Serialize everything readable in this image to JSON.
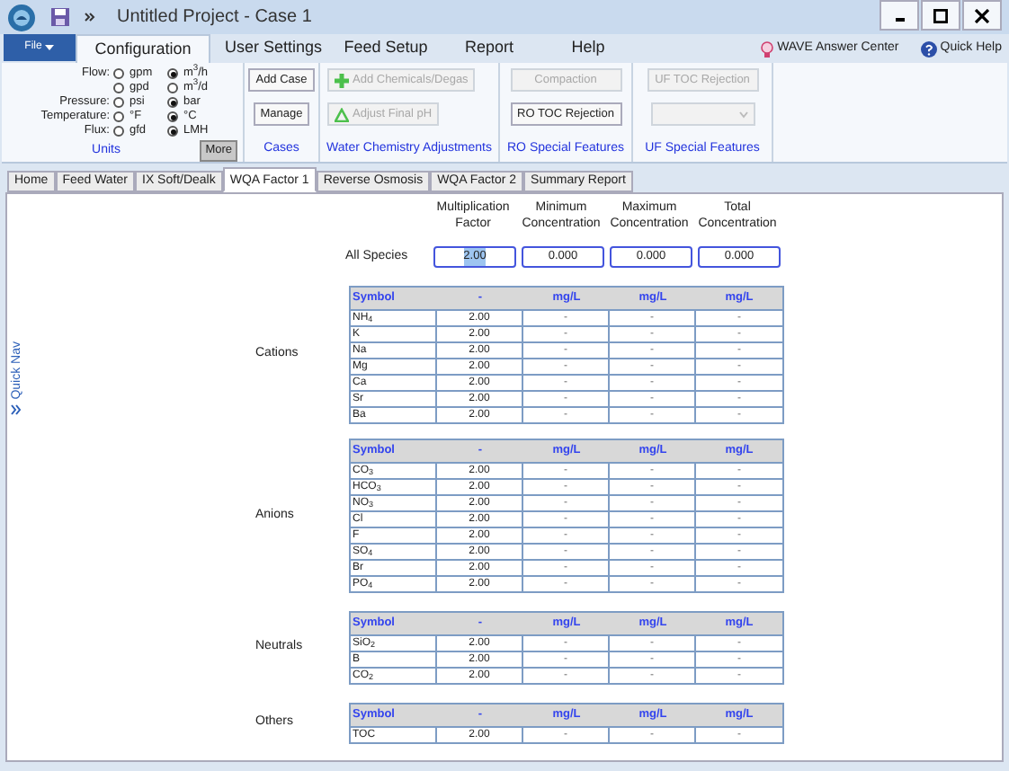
{
  "window": {
    "title": "Untitled Project - Case 1"
  },
  "file_menu": "File",
  "ribbon_tabs": [
    {
      "label": "Configuration",
      "selected": true
    },
    {
      "label": "User Settings",
      "selected": false
    },
    {
      "label": "Feed Setup",
      "selected": false
    },
    {
      "label": "Report",
      "selected": false
    },
    {
      "label": "Help",
      "selected": false
    }
  ],
  "help_links": [
    "WAVE Answer Center",
    "Quick Help"
  ],
  "units": {
    "title": "Units",
    "more": "More",
    "rows": [
      {
        "label": "Flow:",
        "options": [
          {
            "text": "gpm",
            "selected": false
          },
          {
            "text": "m$^{3}$/h",
            "selected": true
          }
        ]
      },
      {
        "options": [
          {
            "text": "gpd",
            "selected": false
          },
          {
            "text": "m$^{3}$/d",
            "selected": false
          }
        ]
      },
      {
        "label": "Pressure:",
        "options": [
          {
            "text": "psi",
            "selected": false
          },
          {
            "text": "bar",
            "selected": true
          }
        ]
      },
      {
        "label": "Temperature:",
        "options": [
          {
            "text": "°F",
            "selected": false
          },
          {
            "text": "°C",
            "selected": true
          }
        ]
      },
      {
        "label": "Flux:",
        "options": [
          {
            "text": "gfd",
            "selected": false
          },
          {
            "text": "LMH",
            "selected": true
          }
        ]
      }
    ]
  },
  "groups": [
    {
      "title": "Cases",
      "buttons": [
        {
          "label": "Add Case",
          "disabled": false
        },
        {
          "label": "Manage",
          "disabled": false
        }
      ]
    },
    {
      "title": "Water Chemistry Adjustments",
      "buttons": [
        {
          "label": "Add Chemicals/Degas",
          "disabled": true,
          "kind": "plus"
        },
        {
          "label": "Adjust Final pH",
          "disabled": true,
          "kind": "triangle"
        }
      ]
    },
    {
      "title": "RO Special Features",
      "buttons": [
        {
          "label": "Compaction",
          "disabled": true
        },
        {
          "label": "RO TOC Rejection",
          "disabled": false
        }
      ]
    },
    {
      "title": "UF Special Features",
      "buttons": [
        {
          "label": "UF TOC Rejection",
          "disabled": true
        },
        {
          "kind": "dropdown",
          "disabled": true
        }
      ]
    }
  ],
  "page_tabs": [
    {
      "label": "Home",
      "selected": false
    },
    {
      "label": "Feed Water",
      "selected": false
    },
    {
      "label": "IX Soft/Dealk",
      "selected": false
    },
    {
      "label": "WQA Factor 1",
      "selected": true
    },
    {
      "label": "Reverse Osmosis",
      "selected": false
    },
    {
      "label": "WQA Factor 2",
      "selected": false
    },
    {
      "label": "Summary Report",
      "selected": false
    }
  ],
  "quick_nav": "Quick Nav",
  "header_labels": [
    "Multiplication Factor",
    "Minimum Concentration",
    "Maximum Concentration",
    "Total Concentration"
  ],
  "all_species": {
    "label": "All Species",
    "values": [
      "2.00",
      "0.000",
      "0.000",
      "0.000"
    ]
  },
  "tables": [
    {
      "label": "Cations",
      "columns": [
        "Symbol",
        "-",
        "mg/L",
        "mg/L",
        "mg/L"
      ],
      "rows": [
        [
          "NH$_{4}$",
          "2.00",
          "-",
          "-",
          "-"
        ],
        [
          "K",
          "2.00",
          "-",
          "-",
          "-"
        ],
        [
          "Na",
          "2.00",
          "-",
          "-",
          "-"
        ],
        [
          "Mg",
          "2.00",
          "-",
          "-",
          "-"
        ],
        [
          "Ca",
          "2.00",
          "-",
          "-",
          "-"
        ],
        [
          "Sr",
          "2.00",
          "-",
          "-",
          "-"
        ],
        [
          "Ba",
          "2.00",
          "-",
          "-",
          "-"
        ]
      ]
    },
    {
      "label": "Anions",
      "columns": [
        "Symbol",
        "-",
        "mg/L",
        "mg/L",
        "mg/L"
      ],
      "rows": [
        [
          "CO$_{3}$",
          "2.00",
          "-",
          "-",
          "-"
        ],
        [
          "HCO$_{3}$",
          "2.00",
          "-",
          "-",
          "-"
        ],
        [
          "NO$_{3}$",
          "2.00",
          "-",
          "-",
          "-"
        ],
        [
          "Cl",
          "2.00",
          "-",
          "-",
          "-"
        ],
        [
          "F",
          "2.00",
          "-",
          "-",
          "-"
        ],
        [
          "SO$_{4}$",
          "2.00",
          "-",
          "-",
          "-"
        ],
        [
          "Br",
          "2.00",
          "-",
          "-",
          "-"
        ],
        [
          "PO$_{4}$",
          "2.00",
          "-",
          "-",
          "-"
        ]
      ]
    },
    {
      "label": "Neutrals",
      "columns": [
        "Symbol",
        "-",
        "mg/L",
        "mg/L",
        "mg/L"
      ],
      "rows": [
        [
          "SiO$_{2}$",
          "2.00",
          "-",
          "-",
          "-"
        ],
        [
          "B",
          "2.00",
          "-",
          "-",
          "-"
        ],
        [
          "CO$_{2}$",
          "2.00",
          "-",
          "-",
          "-"
        ]
      ]
    },
    {
      "label": "Others",
      "columns": [
        "Symbol",
        "-",
        "mg/L",
        "mg/L",
        "mg/L"
      ],
      "rows": [
        [
          "TOC",
          "2.00",
          "-",
          "-",
          "-"
        ]
      ]
    }
  ]
}
